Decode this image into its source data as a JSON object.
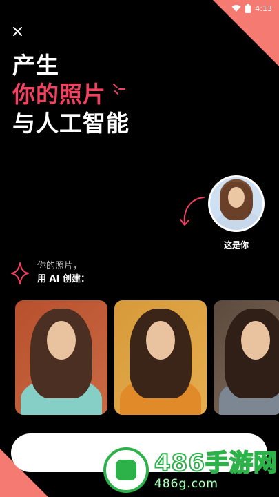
{
  "status_bar": {
    "time": "4:13",
    "icons": [
      "wifi-icon",
      "battery-icon"
    ]
  },
  "header": {
    "close_icon": "close-icon"
  },
  "headline": {
    "line1": "产生",
    "line2": "你的照片",
    "line3": "与人工智能",
    "accent_color": "#f2405f"
  },
  "preview": {
    "caption": "这是你"
  },
  "create_section": {
    "line1": "你的照片，",
    "line2": "用 AI 创建："
  },
  "sample_cards": [
    "card-1",
    "card-2",
    "card-3"
  ],
  "cta": {
    "label": ""
  },
  "watermark": {
    "brand": "486手游网",
    "domain": "486g.com"
  },
  "colors": {
    "background": "#000000",
    "accent": "#f2405f",
    "corner": "#f47a72",
    "watermark_green": "#2db24a"
  }
}
